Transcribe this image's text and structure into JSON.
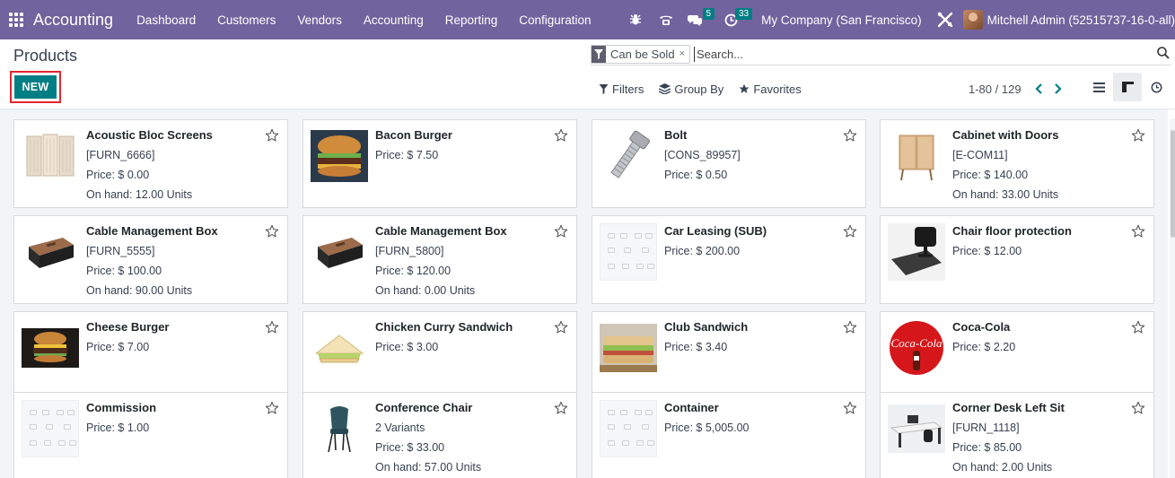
{
  "navbar": {
    "app_title": "Accounting",
    "menu": [
      "Dashboard",
      "Customers",
      "Vendors",
      "Accounting",
      "Reporting",
      "Configuration"
    ],
    "chat_badge": "5",
    "activity_badge": "33",
    "company": "My Company (San Francisco)",
    "user": "Mitchell Admin (52515737-16-0-all)"
  },
  "page": {
    "title": "Products",
    "new_label": "NEW"
  },
  "search": {
    "facet_label": "Can be Sold",
    "facet_remove": "×",
    "placeholder": "Search..."
  },
  "filters": {
    "filters_label": "Filters",
    "group_by_label": "Group By",
    "favorites_label": "Favorites"
  },
  "pager": {
    "value": "1-80 / 129"
  },
  "colors": {
    "brand": "#71639e",
    "primary": "#017e84",
    "highlight": "#e0262f"
  },
  "products": [
    {
      "name": "Acoustic Bloc Screens",
      "lines": [
        "[FURN_6666]",
        "Price: $ 0.00",
        "On hand: 12.00 Units"
      ],
      "image": "screen"
    },
    {
      "name": "Bacon Burger",
      "lines": [
        "Price: $ 7.50"
      ],
      "image": "burger"
    },
    {
      "name": "Bolt",
      "lines": [
        "[CONS_89957]",
        "Price: $ 0.50"
      ],
      "image": "bolt"
    },
    {
      "name": "Cabinet with Doors",
      "lines": [
        "[E-COM11]",
        "Price: $ 140.00",
        "On hand: 33.00 Units"
      ],
      "image": "cabinet"
    },
    {
      "name": "Cable Management Box",
      "lines": [
        "[FURN_5555]",
        "Price: $ 100.00",
        "On hand: 90.00 Units"
      ],
      "image": "cablebox"
    },
    {
      "name": "Cable Management Box",
      "lines": [
        "[FURN_5800]",
        "Price: $ 120.00",
        "On hand: 0.00 Units"
      ],
      "image": "cablebox"
    },
    {
      "name": "Car Leasing (SUB)",
      "lines": [
        "Price: $ 200.00"
      ],
      "image": "placeholder"
    },
    {
      "name": "Chair floor protection",
      "lines": [
        "Price: $ 12.00"
      ],
      "image": "chairmat"
    },
    {
      "name": "Cheese Burger",
      "lines": [
        "Price: $ 7.00"
      ],
      "image": "cheeseburger"
    },
    {
      "name": "Chicken Curry Sandwich",
      "lines": [
        "Price: $ 3.00"
      ],
      "image": "sandwich"
    },
    {
      "name": "Club Sandwich",
      "lines": [
        "Price: $ 3.40"
      ],
      "image": "clubsandwich"
    },
    {
      "name": "Coca-Cola",
      "lines": [
        "Price: $ 2.20"
      ],
      "image": "coke"
    },
    {
      "name": "Commission",
      "lines": [
        "Price: $ 1.00"
      ],
      "image": "placeholder"
    },
    {
      "name": "Conference Chair",
      "lines": [
        "2 Variants",
        "Price: $ 33.00",
        "On hand: 57.00 Units"
      ],
      "image": "chair"
    },
    {
      "name": "Container",
      "lines": [
        "Price: $ 5,005.00"
      ],
      "image": "placeholder"
    },
    {
      "name": "Corner Desk Left Sit",
      "lines": [
        "[FURN_1118]",
        "Price: $ 85.00",
        "On hand: 2.00 Units"
      ],
      "image": "desk"
    }
  ]
}
